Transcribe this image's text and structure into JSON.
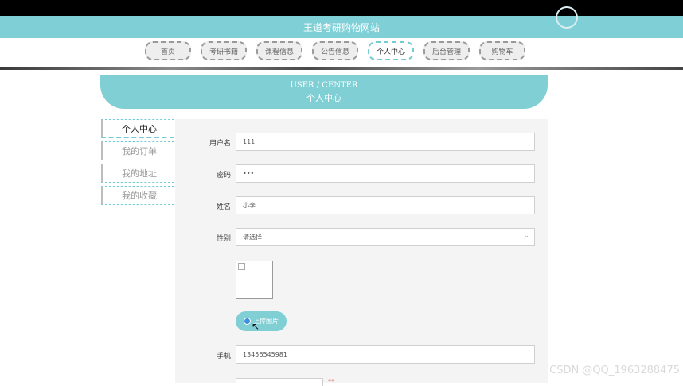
{
  "app": {
    "title": "王道考研购物网站"
  },
  "nav": {
    "items": [
      {
        "label": "首页"
      },
      {
        "label": "考研书籍"
      },
      {
        "label": "课程信息"
      },
      {
        "label": "公告信息"
      },
      {
        "label": "个人中心",
        "active": true
      },
      {
        "label": "后台管理"
      },
      {
        "label": "购物车"
      }
    ]
  },
  "section": {
    "title_en": "USER / CENTER",
    "title_cn": "个人中心"
  },
  "sidebar": {
    "items": [
      {
        "label": "个人中心",
        "active": true
      },
      {
        "label": "我的订单"
      },
      {
        "label": "我的地址"
      },
      {
        "label": "我的收藏"
      }
    ]
  },
  "form": {
    "username": {
      "label": "用户名",
      "value": "111"
    },
    "password": {
      "label": "密码",
      "value": "•••"
    },
    "name": {
      "label": "姓名",
      "value": "小李"
    },
    "gender": {
      "label": "性别",
      "value": "请选择"
    },
    "avatar": {
      "upload_label": "上传图片"
    },
    "phone": {
      "label": "手机",
      "value": "13456545981"
    },
    "required_mark": "**"
  },
  "watermark": "CSDN @QQ_1963288475",
  "colors": {
    "accent": "#80cfd5",
    "title_bar": "#7fcfd6",
    "panel": "#f4f4f4"
  },
  "icons": {
    "select": "chevron-down-icon",
    "upload": "upload-icon",
    "cursor": "cursor-icon"
  }
}
